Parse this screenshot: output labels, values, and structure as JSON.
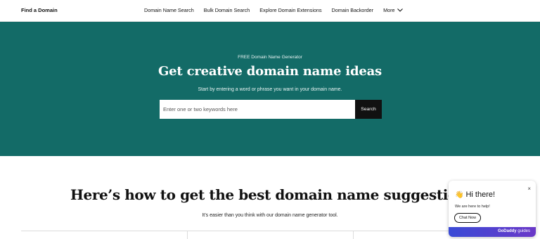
{
  "nav": {
    "brand": "Find a Domain",
    "links": [
      "Domain Name Search",
      "Bulk Domain Search",
      "Explore Domain Extensions",
      "Domain Backorder"
    ],
    "more_label": "More"
  },
  "hero": {
    "kicker": "FREE Domain Name Generator",
    "title": "Get creative domain name ideas",
    "subtitle": "Start by entering a word or phrase you want in your domain name.",
    "search_placeholder": "Enter one or two keywords here",
    "search_button": "Search",
    "bg_color": "#136b67"
  },
  "section": {
    "title": "Here’s how to get the best domain name suggestions",
    "subtitle": "It’s easier than you think with our domain name generator tool."
  },
  "chat": {
    "title": "Hi there!",
    "emoji": "👋",
    "message": "We are here to help!",
    "button": "Chat Now",
    "close": "×",
    "brand_bold": "GoDaddy",
    "brand_rest": " guides"
  }
}
